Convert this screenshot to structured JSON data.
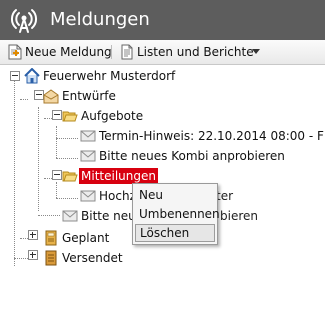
{
  "header": {
    "title": "Meldungen",
    "app_icon": "broadcast-icon"
  },
  "toolbar": {
    "new_message": {
      "label": "Neue Meldung",
      "icon": "new-document-icon"
    },
    "lists_reports": {
      "label": "Listen und Berichte",
      "icon": "document-icon",
      "dropdown": "chevron-down-icon"
    }
  },
  "tree": {
    "root": {
      "label": "Feuerwehr Musterdorf",
      "icon": "house-icon"
    },
    "drafts": {
      "label": "Entwürfe",
      "icon": "envelope-open-icon"
    },
    "offers": {
      "label": "Aufgebote",
      "icon": "folder-open-icon"
    },
    "offer_item_1": {
      "label": "Termin-Hinweis: 22.10.2014 08:00 - F",
      "icon": "envelope-icon"
    },
    "offer_item_2": {
      "label": "Bitte neues Kombi anprobieren",
      "icon": "envelope-icon"
    },
    "notices": {
      "label": "Mitteilungen",
      "icon": "folder-open-icon"
    },
    "notice_item_1": {
      "label": "Hochz",
      "label_tail": "ter",
      "icon": "envelope-icon"
    },
    "drafts_item": {
      "label": "Bitte neu",
      "label_tail": "bieren",
      "icon": "envelope-icon"
    },
    "planned": {
      "label": "Geplant",
      "icon": "calendar-icon"
    },
    "sent": {
      "label": "Versendet",
      "icon": "archive-icon"
    }
  },
  "context_menu": {
    "items": [
      {
        "label": "Neu"
      },
      {
        "label": "Umbenennen"
      },
      {
        "label": "Löschen"
      }
    ]
  },
  "colors": {
    "header_bg": "#5d5d5d",
    "selected_bg": "#d8000f",
    "menu_bg": "#f5f5f5"
  }
}
